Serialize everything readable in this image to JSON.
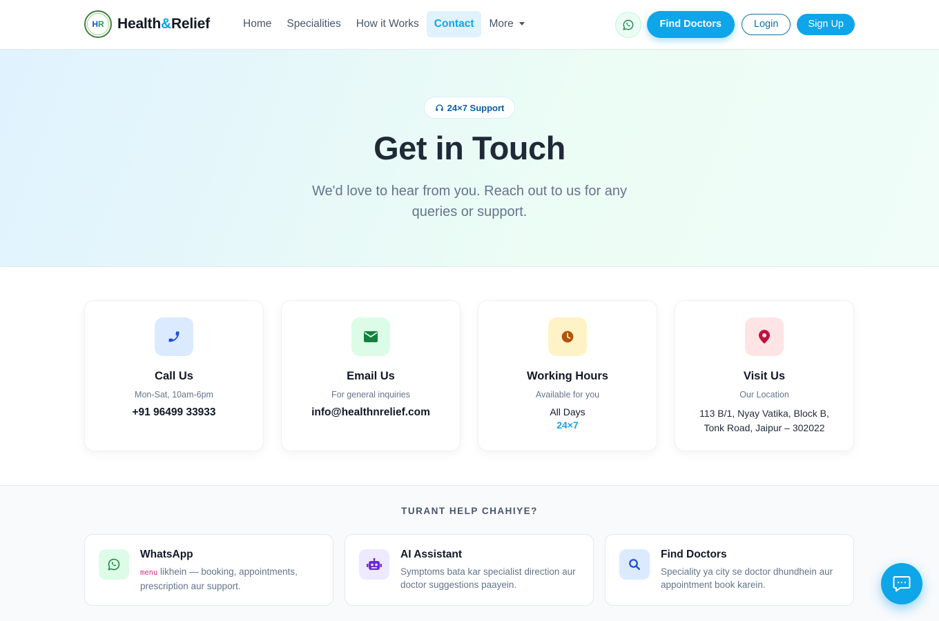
{
  "brand": {
    "name_part1": "Health",
    "name_amp": "&",
    "name_part2": "Relief",
    "logo_text": "HR"
  },
  "nav": {
    "links": [
      {
        "label": "Home"
      },
      {
        "label": "Specialities"
      },
      {
        "label": "How it Works"
      },
      {
        "label": "Contact",
        "active": true
      },
      {
        "label": "More"
      }
    ],
    "find_doctors": "Find Doctors",
    "login": "Login",
    "signup": "Sign Up"
  },
  "hero": {
    "badge": "24×7 Support",
    "title": "Get in Touch",
    "subtitle": "We'd love to hear from you. Reach out to us for any queries or support."
  },
  "cards": [
    {
      "title": "Call Us",
      "sub": "Mon-Sat, 10am-6pm",
      "value": "+91 96499 33933",
      "icon": "phone-icon",
      "icon_bg": "#dbeafe",
      "icon_color": "#1d4ed8"
    },
    {
      "title": "Email Us",
      "sub": "For general inquiries",
      "value": "info@healthnrelief.com",
      "icon": "envelope-icon",
      "icon_bg": "#dcfce7",
      "icon_color": "#15803d"
    },
    {
      "title": "Working Hours",
      "sub": "Available for you",
      "value": "All Days",
      "highlight": "24×7",
      "icon": "clock-icon",
      "icon_bg": "#fef3c7",
      "icon_color": "#b45309"
    },
    {
      "title": "Visit Us",
      "sub": "Our Location",
      "value_line1": "113 B/1, Nyay Vatika, Block B,",
      "value_line2": "Tonk Road, Jaipur – 302022",
      "icon": "map-pin-icon",
      "icon_bg": "#ffe4e6",
      "icon_color": "#be123c"
    }
  ],
  "help": {
    "title": "TURANT HELP CHAHIYE?",
    "items": [
      {
        "title": "WhatsApp",
        "code": "menu",
        "desc_rest": " likhein — booking, appointments, prescription aur support.",
        "icon": "whatsapp-icon",
        "icon_bg": "#dcfce7"
      },
      {
        "title": "AI Assistant",
        "desc": "Symptoms bata kar specialist direction aur doctor suggestions paayein.",
        "icon": "robot-icon",
        "icon_bg": "#ede9fe"
      },
      {
        "title": "Find Doctors",
        "desc": "Speciality ya city se doctor dhundhein aur appointment book karein.",
        "icon": "search-icon",
        "icon_bg": "#dbeafe"
      }
    ]
  },
  "chat_fab": {
    "icon": "chat-icon"
  }
}
